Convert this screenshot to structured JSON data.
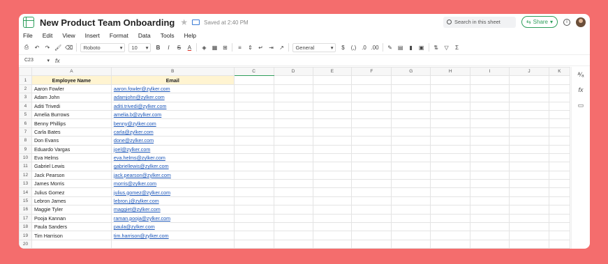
{
  "title_bar": {
    "doc_title": "New Product Team Onboarding",
    "saved_status": "Saved at 2:40 PM",
    "search_placeholder": "Search in this sheet",
    "share_label": "Share",
    "info_glyph": "i",
    "star_glyph": "★"
  },
  "menu": [
    "File",
    "Edit",
    "View",
    "Insert",
    "Format",
    "Data",
    "Tools",
    "Help"
  ],
  "toolbar": {
    "font": "Roboto",
    "font_size": "10",
    "bold": "B",
    "italic": "I",
    "strike": "S",
    "text_color": "A",
    "number_format": "General",
    "currency": "$",
    "sigma": "Σ"
  },
  "formula_bar": {
    "cell_ref": "C23",
    "fx": "fx"
  },
  "columns": [
    "A",
    "B",
    "C",
    "D",
    "E",
    "F",
    "G",
    "H",
    "I",
    "J",
    "K"
  ],
  "selected_column": "C",
  "header_row": [
    "Employee Name",
    "Email"
  ],
  "rows": [
    {
      "name": "Aaron Fowler",
      "email": "aaron.fowler@zylker.com"
    },
    {
      "name": "Adam John",
      "email": "adamjohn@zylker.com"
    },
    {
      "name": "Aditi Trivedi",
      "email": "aditi.trivedi@zylker.com"
    },
    {
      "name": "Amelia Burrows",
      "email": "amelia.b@zylker.com"
    },
    {
      "name": "Benny Phillips",
      "email": "benny@zylker.com"
    },
    {
      "name": "Carla Bates",
      "email": "carla@zylker.com"
    },
    {
      "name": "Don Evans",
      "email": "done@zylker.com"
    },
    {
      "name": "Eduardo Vargas",
      "email": "joel@zylker.com"
    },
    {
      "name": "Eva Helms",
      "email": "eva.helms@zylker.com"
    },
    {
      "name": "Gabriel Lewis",
      "email": "gabriellewis@zylker.com"
    },
    {
      "name": "Jack Pearson",
      "email": "jack.pearson@zylker.com"
    },
    {
      "name": "James Morris",
      "email": "morris@zylker.com"
    },
    {
      "name": "Julius Gomez",
      "email": "julius.gomez@zylker.com"
    },
    {
      "name": "Lebron James",
      "email": "lebron.j@zylker.com"
    },
    {
      "name": "Maggie Tyler",
      "email": "maggiet@zylker.com"
    },
    {
      "name": "Pooja Kannan",
      "email": "raman.pooja@zylker.com"
    },
    {
      "name": "Paula Sanders",
      "email": "paula@zylker.com"
    },
    {
      "name": "Tim Harrison",
      "email": "tim.harrison@zylker.com"
    }
  ],
  "last_row_number": "20",
  "colors": {
    "background": "#f46d6d",
    "accent": "#2e9e5b",
    "link": "#1a55b8",
    "header_fill": "#fff4d1"
  }
}
